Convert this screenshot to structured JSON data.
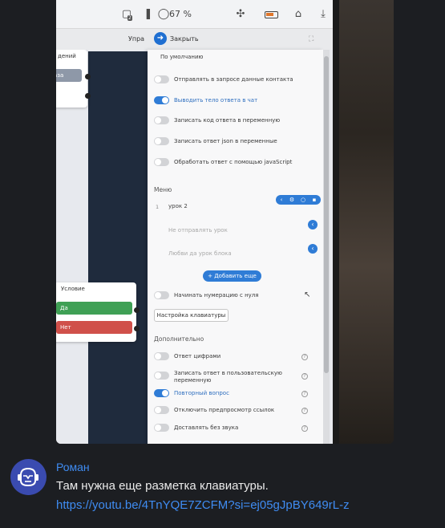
{
  "browser": {
    "zoom": "67 %",
    "tab_badge": "2"
  },
  "panel": {
    "upra_label": "Упра",
    "close_label": "Закрыть",
    "default_value": "По умолчанию",
    "toggles": [
      {
        "label": "Отправлять в запросе данные контакта",
        "on": false
      },
      {
        "label": "Выводить тело ответа в чат",
        "on": true
      },
      {
        "label": "Записать код ответа в переменную",
        "on": false
      },
      {
        "label": "Записать ответ json в переменные",
        "on": false
      },
      {
        "label": "Обработать ответ с помощью javaScript",
        "on": false
      }
    ],
    "menu_section": "Меню",
    "menu_items": [
      {
        "num": "1",
        "text": "урок 2"
      },
      {
        "num": "",
        "text": "Не отправлять урок"
      },
      {
        "num": "",
        "text": "Любви да урок блока"
      }
    ],
    "add_button": "+ Добавить еще",
    "numbering_toggle": "Начинать нумерацию с нуля",
    "keyboard_button": "Настройка клавиатуры",
    "additional_section": "Дополнительно",
    "extra_toggles": [
      {
        "label": "Ответ цифрами",
        "on": false
      },
      {
        "label": "Записать ответ в пользовательскую переменную",
        "on": false
      },
      {
        "label": "Повторный вопрос",
        "on": true
      },
      {
        "label": "Отключить предпросмотр ссылок",
        "on": false
      },
      {
        "label": "Доставлять без звука",
        "on": false
      }
    ]
  },
  "canvas": {
    "top_node_title": "дений",
    "top_node_button": "аза",
    "condition_node_title": "Условие",
    "yes_label": "Да",
    "no_label": "Нет"
  },
  "message": {
    "author": "Роман",
    "text": "Там нужна еще разметка клавиатуры.",
    "link": "https://youtu.be/4TnYQE7ZCFM?si=ej05gJpBY649rL-z"
  },
  "colors": {
    "accent": "#2f7cd6",
    "author_name": "#3f8cf2",
    "chat_bg": "#1c1e22",
    "yes_green": "#3fa055",
    "no_red": "#d0504a"
  }
}
